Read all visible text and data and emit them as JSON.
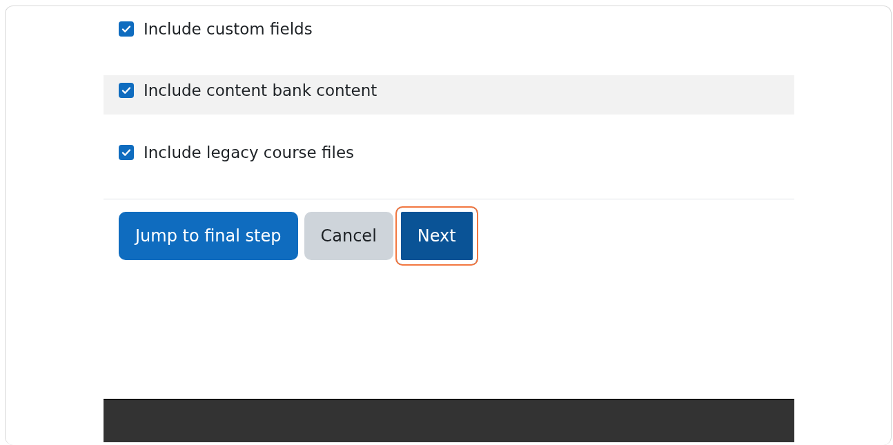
{
  "options": [
    {
      "label": "Include custom fields",
      "checked": true,
      "shaded": false
    },
    {
      "label": "Include content bank content",
      "checked": true,
      "shaded": true
    },
    {
      "label": "Include legacy course files",
      "checked": true,
      "shaded": false
    }
  ],
  "buttons": [
    {
      "label": "Jump to final step",
      "kind": "primary",
      "highlighted": false
    },
    {
      "label": "Cancel",
      "kind": "secondary",
      "highlighted": false
    },
    {
      "label": "Next",
      "kind": "focused",
      "highlighted": true
    }
  ]
}
